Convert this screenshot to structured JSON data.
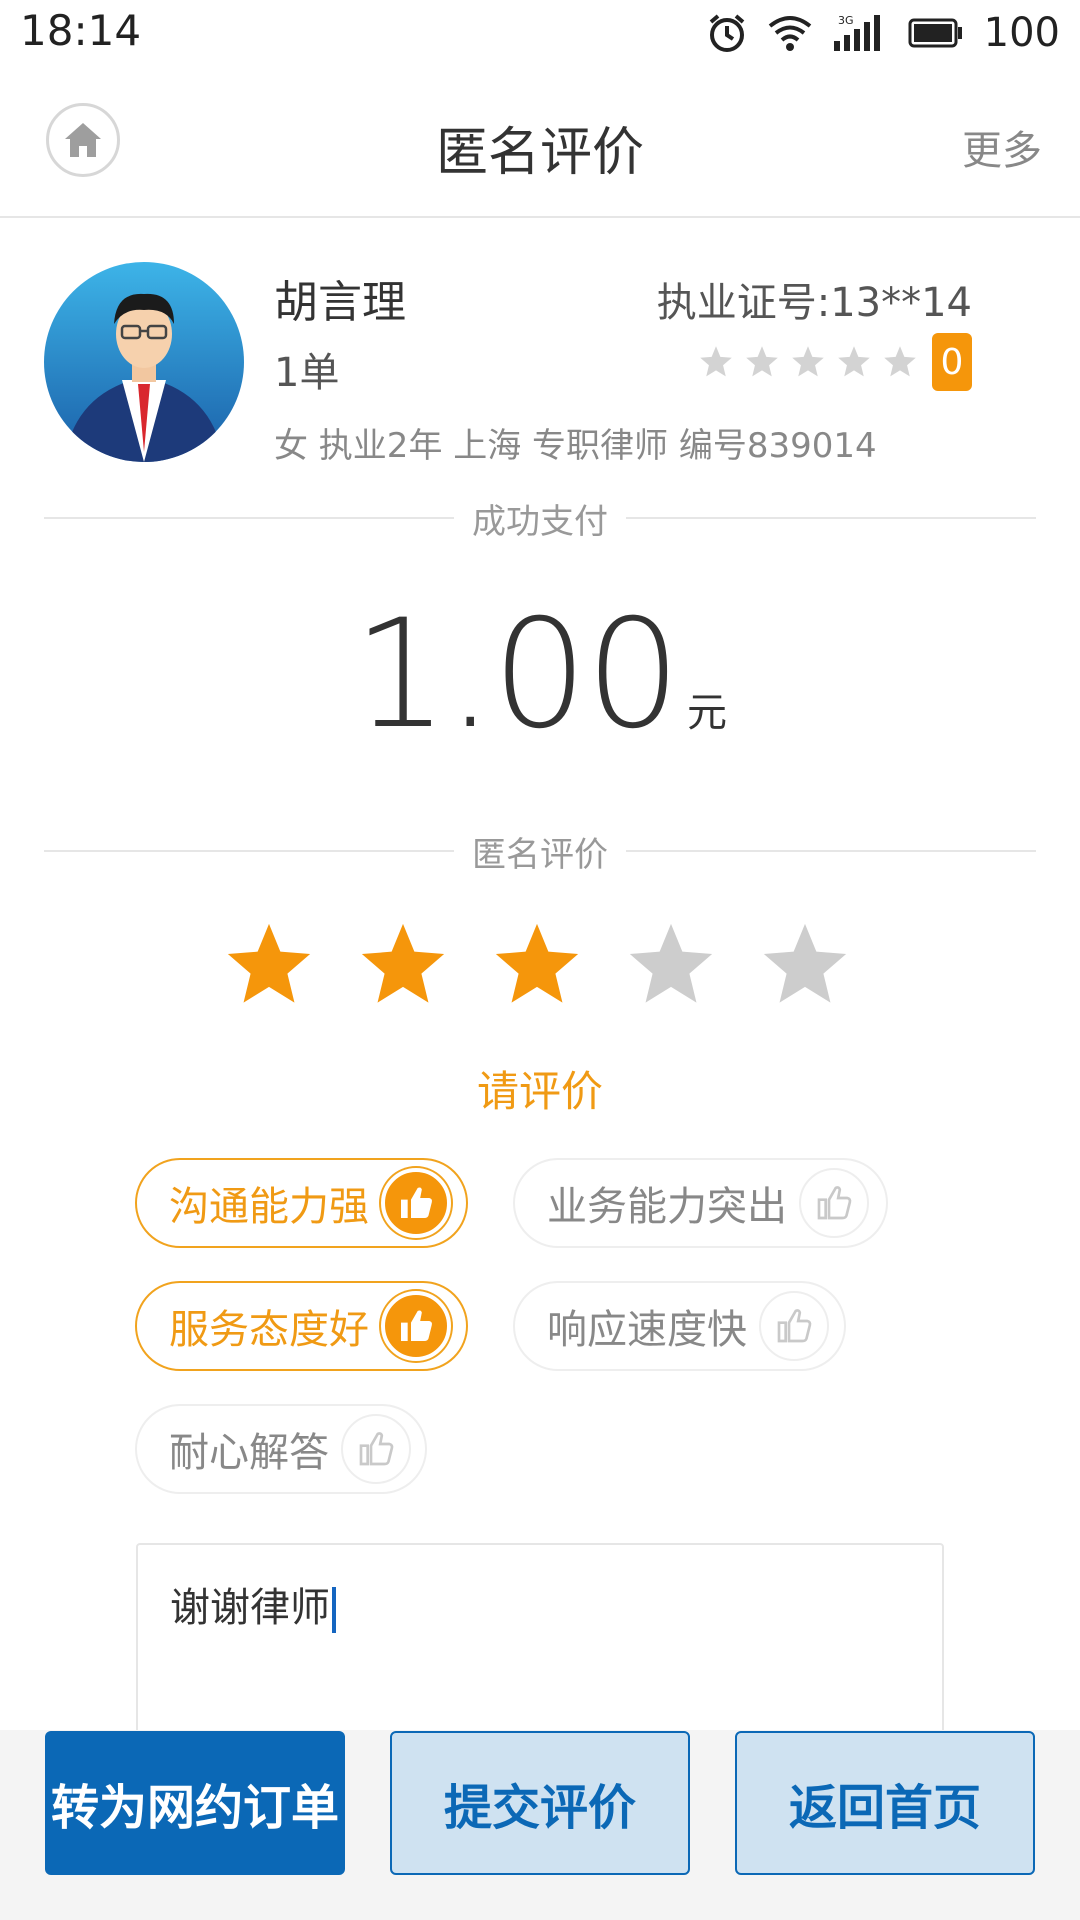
{
  "status_bar": {
    "time": "18:14",
    "network": "3G",
    "battery": "100"
  },
  "header": {
    "title": "匿名评价",
    "more_label": "更多"
  },
  "lawyer": {
    "name": "胡言理",
    "license": "执业证号:13**14",
    "orders": "1单",
    "rating_count": "0",
    "info": "女 执业2年 上海 专职律师 编号839014"
  },
  "payment": {
    "section_label": "成功支付",
    "amount": "1.00",
    "unit": "元"
  },
  "review": {
    "section_label": "匿名评价",
    "stars_total": 5,
    "stars_selected": 3,
    "prompt": "请评价",
    "tags": [
      {
        "label": "沟通能力强",
        "selected": true
      },
      {
        "label": "业务能力突出",
        "selected": false
      },
      {
        "label": "服务态度好",
        "selected": true
      },
      {
        "label": "响应速度快",
        "selected": false
      },
      {
        "label": "耐心解答",
        "selected": false
      }
    ],
    "comment": "谢谢律师"
  },
  "actions": {
    "convert_label": "转为网约订单",
    "submit_label": "提交评价",
    "home_label": "返回首页"
  },
  "colors": {
    "accent_orange": "#f5960b",
    "primary_blue": "#0b68b6",
    "light_blue": "#cfe2f1"
  }
}
